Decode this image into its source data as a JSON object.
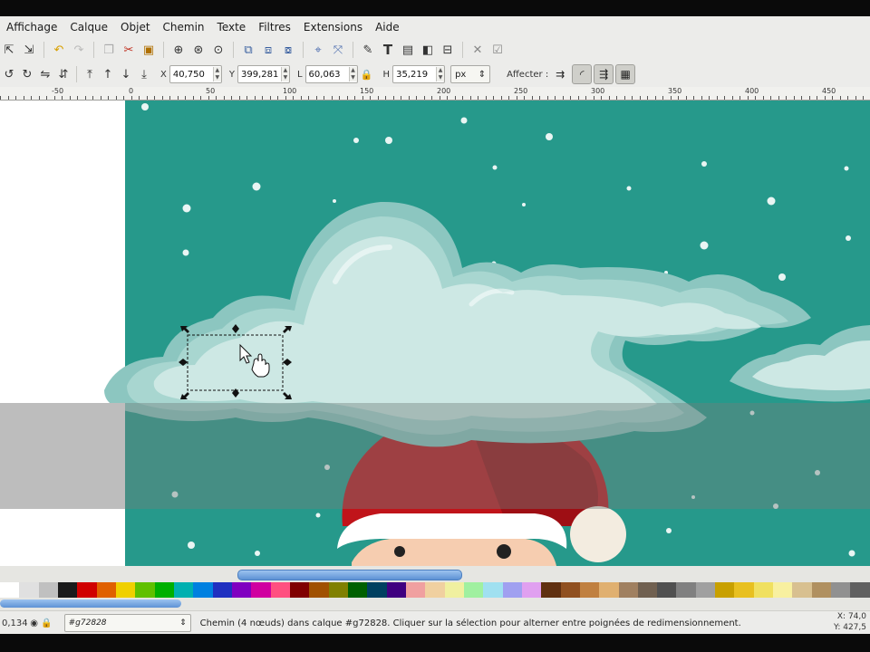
{
  "menu": [
    "Affichage",
    "Calque",
    "Objet",
    "Chemin",
    "Texte",
    "Filtres",
    "Extensions",
    "Aide"
  ],
  "toolbar1_icons": [
    "import-icon",
    "export-icon",
    "undo-icon",
    "redo-icon",
    "duplicate-icon",
    "cut-icon",
    "paste-icon",
    "zoom-selection-icon",
    "zoom-drawing-icon",
    "zoom-page-icon",
    "group-icon",
    "ungroup-icon",
    "clone-icon",
    "node-editor-icon",
    "transform-icon",
    "fill-stroke-icon",
    "text-tool-icon",
    "layers-icon",
    "xml-editor-icon",
    "align-icon",
    "preferences-icon",
    "doc-properties-icon"
  ],
  "toolbar2": {
    "x_label": "X",
    "x_value": "40,750",
    "y_label": "Y",
    "y_value": "399,281",
    "w_label": "L",
    "w_value": "60,063",
    "h_label": "H",
    "h_value": "35,219",
    "unit": "px",
    "affect_label": "Affecter :"
  },
  "ruler_labels": [
    "-50",
    "0",
    "50",
    "100",
    "150",
    "200",
    "250",
    "300",
    "350",
    "400",
    "450"
  ],
  "canvas": {
    "background_color": "#26998b",
    "cloud_light": "#cde8e4",
    "cloud_mid": "#a8d6d0",
    "cloud_dark": "#8cc6c0",
    "hat_color": "#c0141a",
    "hat_shadow": "#9e0e14",
    "pompom": "#f3ece0",
    "face": "#f6cdb0"
  },
  "palette_colors": [
    "#ffffff",
    "#e0e0e0",
    "#c0c0c0",
    "#1a1a1a",
    "#d00000",
    "#e06000",
    "#f0d000",
    "#60c000",
    "#00b000",
    "#00b0b0",
    "#0080e0",
    "#2030c0",
    "#8000c0",
    "#d000a0",
    "#ff5080",
    "#800000",
    "#a05000",
    "#808000",
    "#006000",
    "#004060",
    "#400080",
    "#f0a0a0",
    "#f0d0a0",
    "#f0f0a0",
    "#a0f0a0",
    "#a0e0f0",
    "#a0a0f0",
    "#e0a0f0",
    "#603010",
    "#905020",
    "#c08040",
    "#e0b070",
    "#a08060",
    "#706050",
    "#505050",
    "#808080",
    "#a0a0a0",
    "#c8a000",
    "#e8c020",
    "#f0e060",
    "#f8f0a0",
    "#d8c090",
    "#b09060",
    "#909090",
    "#606060"
  ],
  "status": {
    "opacity": "0,134",
    "layer": "#g72828",
    "message": "Chemin (4 nœuds) dans calque #g72828. Cliquer sur la sélection pour alterner entre poignées de redimensionnement.",
    "x_label": "X:",
    "x_value": "74,0",
    "y_label": "Y:",
    "y_value": "427,5"
  }
}
